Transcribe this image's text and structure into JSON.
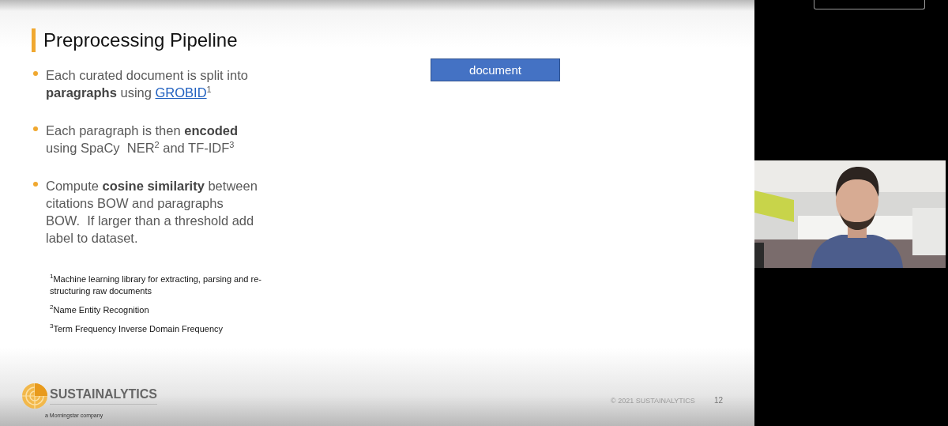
{
  "slide": {
    "title": "Preprocessing Pipeline",
    "bullets": [
      {
        "text": "Each curated document is split into **paragraphs** using ",
        "link": "GROBID",
        "note": "1"
      },
      {
        "text": "Each paragraph is then **encoded** using SpaCy  NER$^{2}$ and TF-IDF$^{3}$"
      },
      {
        "text": "Compute **cosine similarity** between citations BOW and paragraphs BOW.  If larger than a threshold add label to dataset."
      }
    ],
    "footnotes": [
      "$^{1}$Machine learning library for extracting, parsing and re-structuring raw documents",
      "$^{2}$Name Entity Recognition",
      "$^{3}$Term Frequency Inverse Domain Frequency"
    ],
    "diagram_box": "document",
    "logo": {
      "name": "SUSTAINALYTICS",
      "tagline": "a Morningstar company"
    },
    "copyright": "© 2021 SUSTAINALYTICS",
    "page_number": "12"
  }
}
